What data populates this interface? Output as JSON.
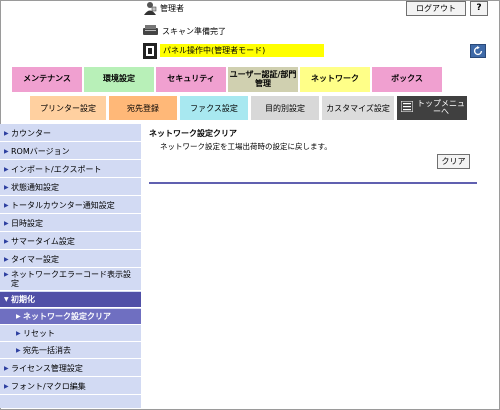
{
  "header": {
    "user_label": "管理者",
    "logout_label": "ログアウト",
    "help_label": "?",
    "scan_status": "スキャン準備完了",
    "panel_status": "パネル操作中(管理者モード)"
  },
  "main_tabs": [
    {
      "label": "メンテナンス",
      "color": "#f0a0d0"
    },
    {
      "label": "環境設定",
      "color": "#b8f0b8"
    },
    {
      "label": "セキュリティ",
      "color": "#f0a0d0"
    },
    {
      "label": "ユーザー認証/部門管理",
      "color": "#d0d0b0"
    },
    {
      "label": "ネットワーク",
      "color": "#ffff88"
    },
    {
      "label": "ボックス",
      "color": "#f0a0d0"
    }
  ],
  "sub_tabs": [
    {
      "label": "プリンター設定",
      "color": "#ffd0a0"
    },
    {
      "label": "宛先登録",
      "color": "#ffb878"
    },
    {
      "label": "ファクス設定",
      "color": "#a8e8f0"
    },
    {
      "label": "目的別設定",
      "color": "#d8d8d8"
    },
    {
      "label": "カスタマイズ設定",
      "color": "#dcdcdc"
    },
    {
      "label": "トップメニューへ",
      "color": "#404040"
    }
  ],
  "sidebar": {
    "items": [
      {
        "label": "カウンター"
      },
      {
        "label": "ROMバージョン"
      },
      {
        "label": "インポート/エクスポート"
      },
      {
        "label": "状態通知設定"
      },
      {
        "label": "トータルカウンター通知設定"
      },
      {
        "label": "日時設定"
      },
      {
        "label": "サマータイム設定"
      },
      {
        "label": "タイマー設定"
      },
      {
        "label": "ネットワークエラーコード表示設定"
      },
      {
        "label": "初期化"
      },
      {
        "label": "ネットワーク設定クリア"
      },
      {
        "label": "リセット"
      },
      {
        "label": "宛先一括消去"
      },
      {
        "label": "ライセンス管理設定"
      },
      {
        "label": "フォント/マクロ編集"
      }
    ]
  },
  "content": {
    "title": "ネットワーク設定クリア",
    "description": "ネットワーク設定を工場出荷時の設定に戻します。",
    "clear_label": "クリア"
  },
  "colors": {
    "sidebar_bg": "#d2daf3",
    "sidebar_active": "#4f4fa7",
    "sidebar_sub_active": "#6f6fc1",
    "panel_status_bg": "#ffff00"
  }
}
